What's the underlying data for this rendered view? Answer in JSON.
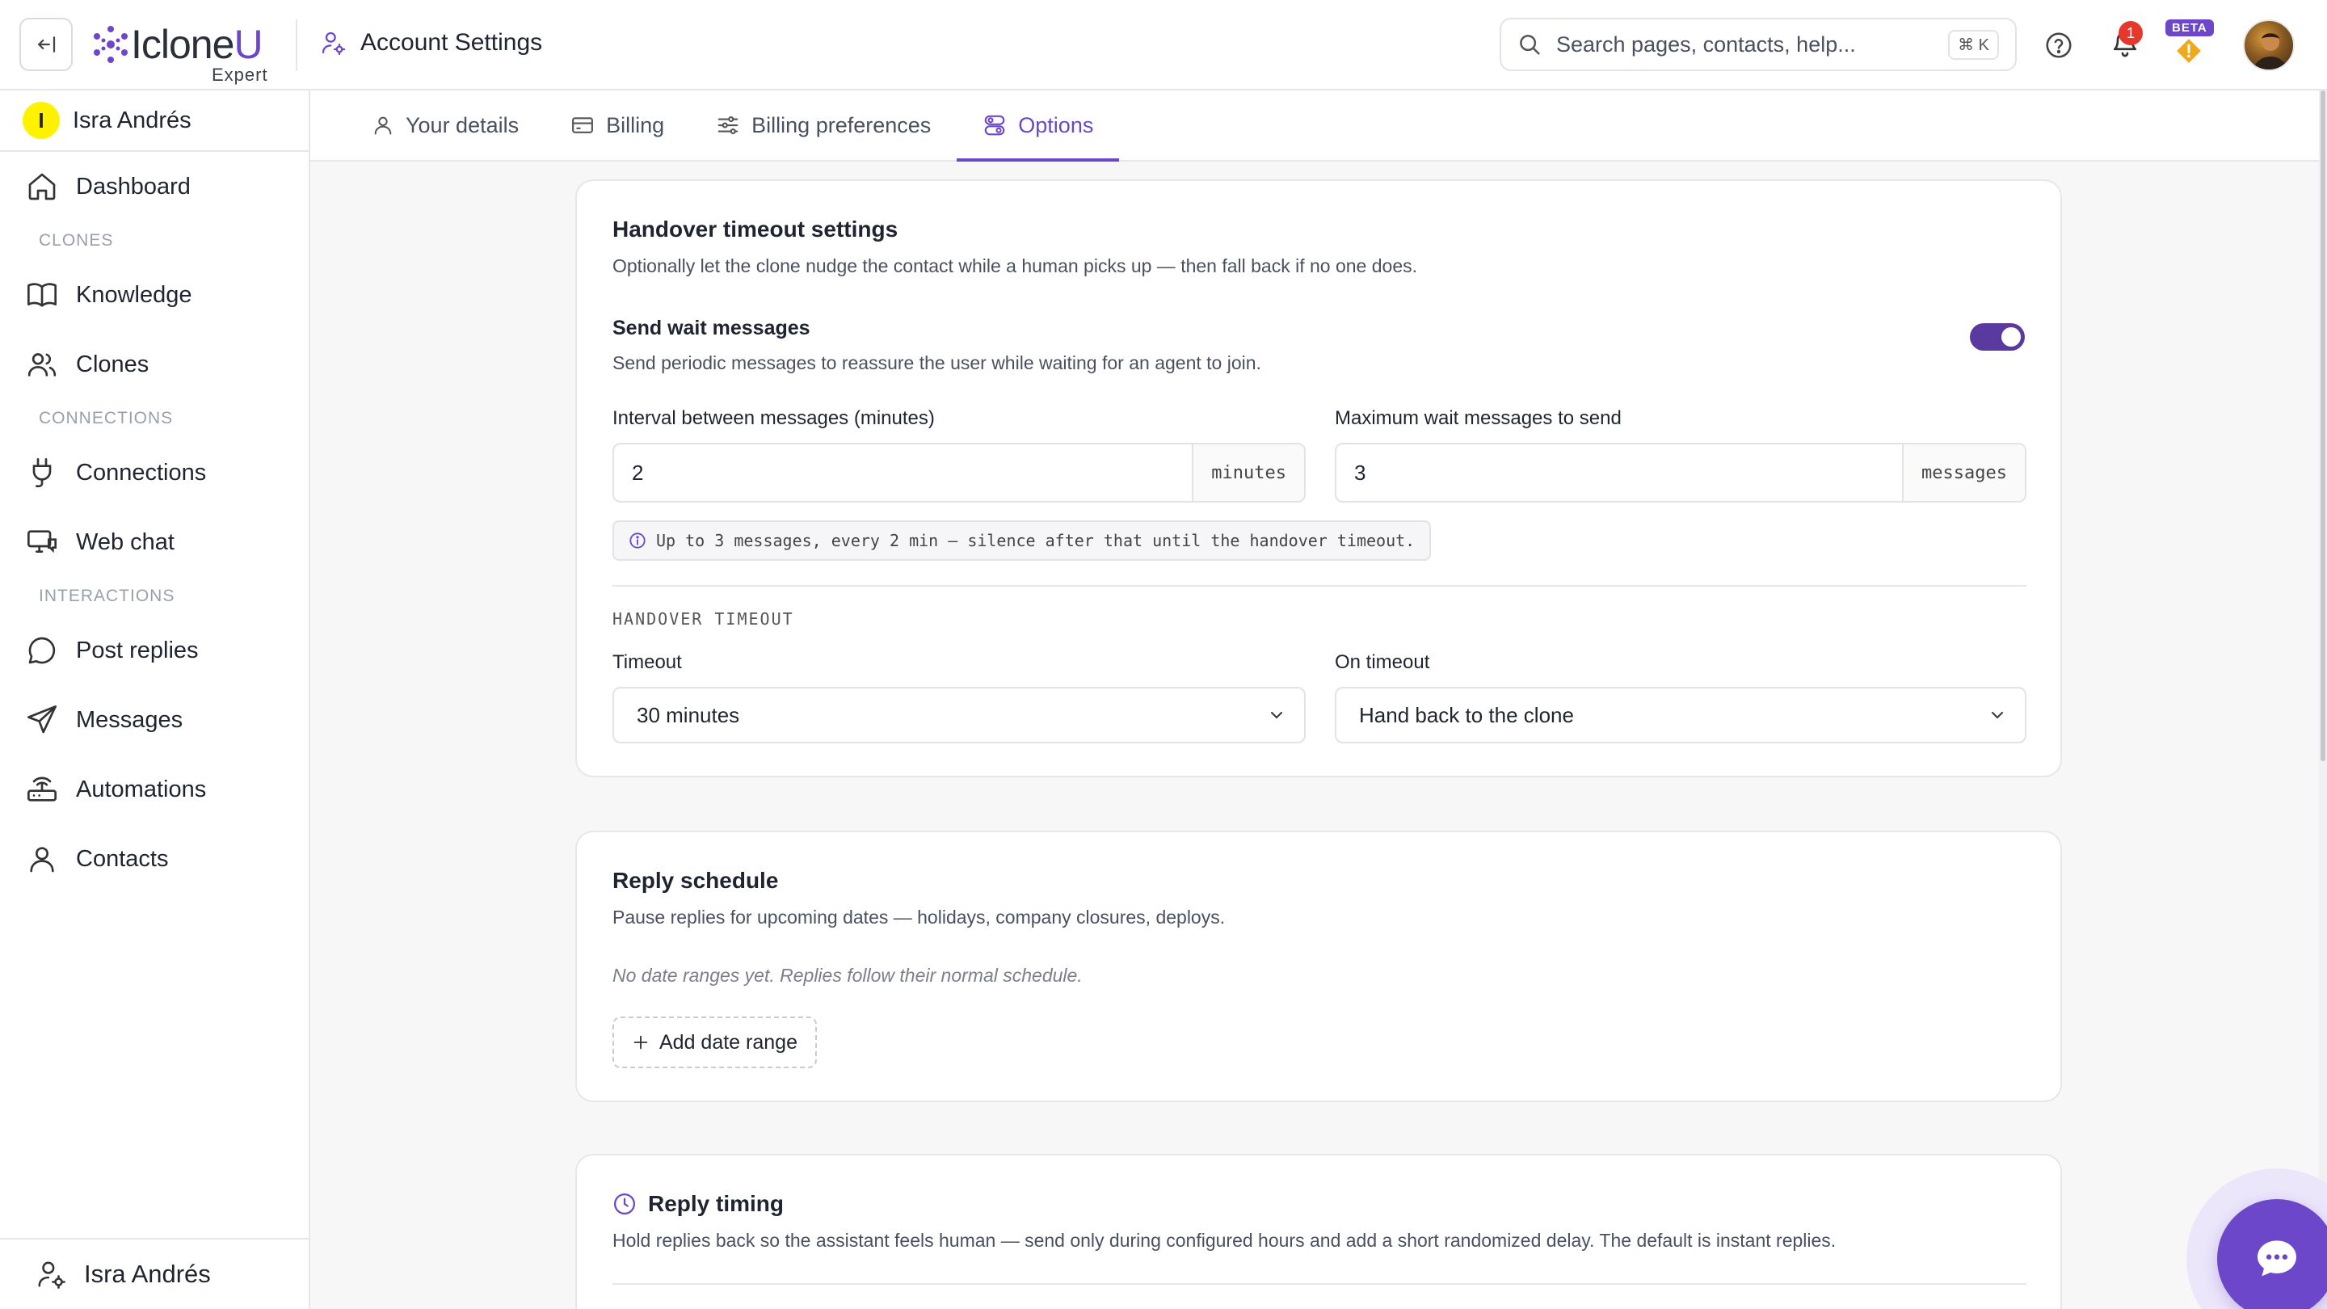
{
  "app": {
    "logo_main": "Iclone",
    "logo_accent": "U",
    "logo_sub": "Expert",
    "page_title": "Account Settings"
  },
  "search": {
    "placeholder": "Search pages, contacts, help...",
    "shortcut": "⌘ K"
  },
  "header": {
    "notifications_count": "1",
    "beta_label": "BETA"
  },
  "sidebar": {
    "org_initial": "I",
    "org_name": "Isra Andrés",
    "items": [
      {
        "label": "Dashboard"
      },
      {
        "section": "CLONES"
      },
      {
        "label": "Knowledge"
      },
      {
        "label": "Clones"
      },
      {
        "section": "CONNECTIONS"
      },
      {
        "label": "Connections"
      },
      {
        "label": "Web chat"
      },
      {
        "section": "INTERACTIONS"
      },
      {
        "label": "Post replies"
      },
      {
        "label": "Messages"
      },
      {
        "label": "Automations"
      },
      {
        "label": "Contacts"
      }
    ],
    "footer_user": "Isra Andrés"
  },
  "tabs": [
    {
      "label": "Your details"
    },
    {
      "label": "Billing"
    },
    {
      "label": "Billing preferences"
    },
    {
      "label": "Options",
      "active": true
    }
  ],
  "handover": {
    "title": "Handover timeout settings",
    "desc": "Optionally let the clone nudge the contact while a human picks up — then fall back if no one does.",
    "wait_title": "Send wait messages",
    "wait_desc": "Send periodic messages to reassure the user while waiting for an agent to join.",
    "wait_enabled": true,
    "interval_label": "Interval between messages (minutes)",
    "interval_value": "2",
    "interval_unit": "minutes",
    "max_label": "Maximum wait messages to send",
    "max_value": "3",
    "max_unit": "messages",
    "info": "Up to 3 messages, every 2 min — silence after that until the handover timeout.",
    "section_label": "HANDOVER TIMEOUT",
    "timeout_label": "Timeout",
    "timeout_value": "30 minutes",
    "on_timeout_label": "On timeout",
    "on_timeout_value": "Hand back to the clone"
  },
  "schedule": {
    "title": "Reply schedule",
    "desc": "Pause replies for upcoming dates — holidays, company closures, deploys.",
    "empty": "No date ranges yet. Replies follow their normal schedule.",
    "add_label": "Add date range"
  },
  "timing": {
    "title": "Reply timing",
    "desc": "Hold replies back so the assistant feels human — send only during configured hours and add a short randomized delay. The default is instant replies."
  },
  "colors": {
    "accent": "#6c47c9",
    "toggle_on": "#5a3a9e",
    "badge_red": "#e5372c",
    "org_dot": "#fff200"
  }
}
